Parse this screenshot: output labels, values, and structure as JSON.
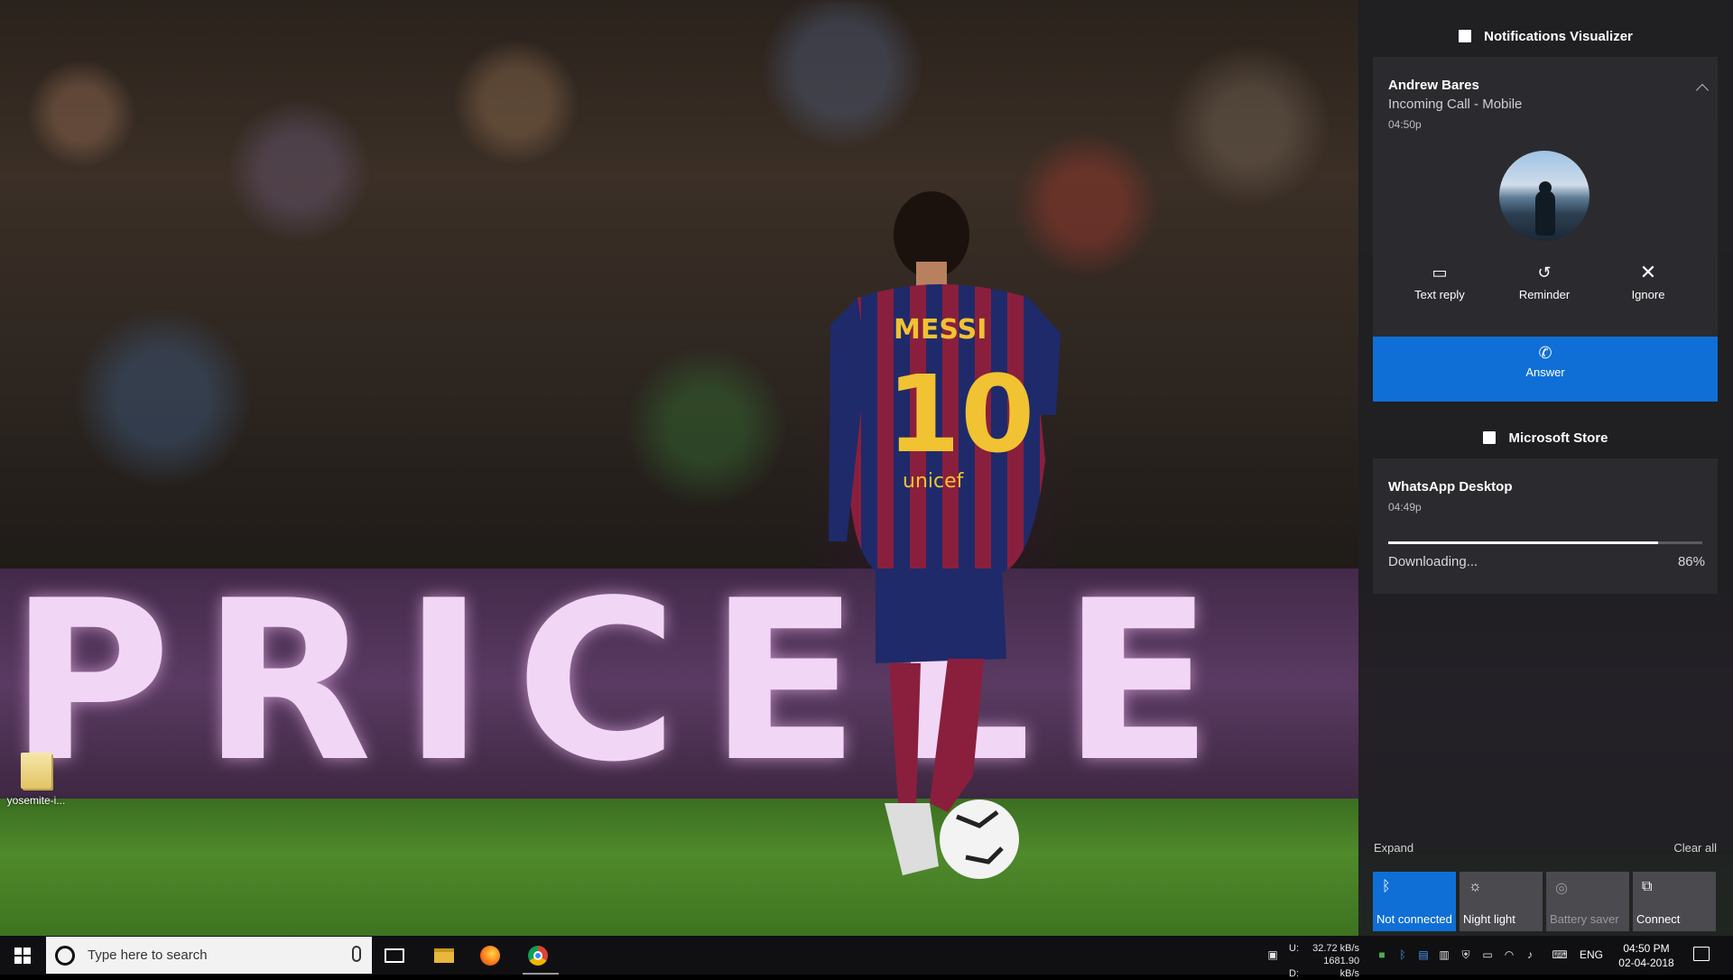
{
  "desktop": {
    "banner_text": "PRICELE",
    "player_name": "MESSI",
    "player_number": "10",
    "sponsor": "unicef",
    "icon_label": "yosemite-i..."
  },
  "action_center": {
    "app1": {
      "name": "Notifications Visualizer",
      "icon": "app-icon"
    },
    "call_notification": {
      "title": "Andrew Bares",
      "subtitle": "Incoming Call - Mobile",
      "time": "04:50p",
      "actions": [
        {
          "label": "Text reply",
          "icon": "message-icon"
        },
        {
          "label": "Reminder",
          "icon": "reminder-icon"
        },
        {
          "label": "Ignore",
          "icon": "close-icon"
        }
      ],
      "answer_label": "Answer"
    },
    "app2": {
      "name": "Microsoft Store",
      "icon": "store-icon"
    },
    "download_notification": {
      "title": "WhatsApp Desktop",
      "time": "04:49p",
      "progress": 0.86,
      "status": "Downloading...",
      "percent": "86%"
    },
    "expand_label": "Expand",
    "clear_all_label": "Clear all",
    "quick_actions": [
      {
        "label": "Not connected",
        "icon": "bluetooth-icon",
        "active": true
      },
      {
        "label": "Night light",
        "icon": "night-light-icon",
        "active": false
      },
      {
        "label": "Battery saver",
        "icon": "battery-saver-icon",
        "active": false,
        "disabled": true
      },
      {
        "label": "Connect",
        "icon": "connect-icon",
        "active": false
      }
    ]
  },
  "taskbar": {
    "search_placeholder": "Type here to search",
    "net_upload_label": "U:",
    "net_download_label": "D:",
    "net_upload": "32.72 kB/s",
    "net_download": "1681.90 kB/s",
    "language": "ENG",
    "time": "04:50 PM",
    "date": "02-04-2018",
    "colors": {
      "accent": "#0f6fd6"
    }
  }
}
